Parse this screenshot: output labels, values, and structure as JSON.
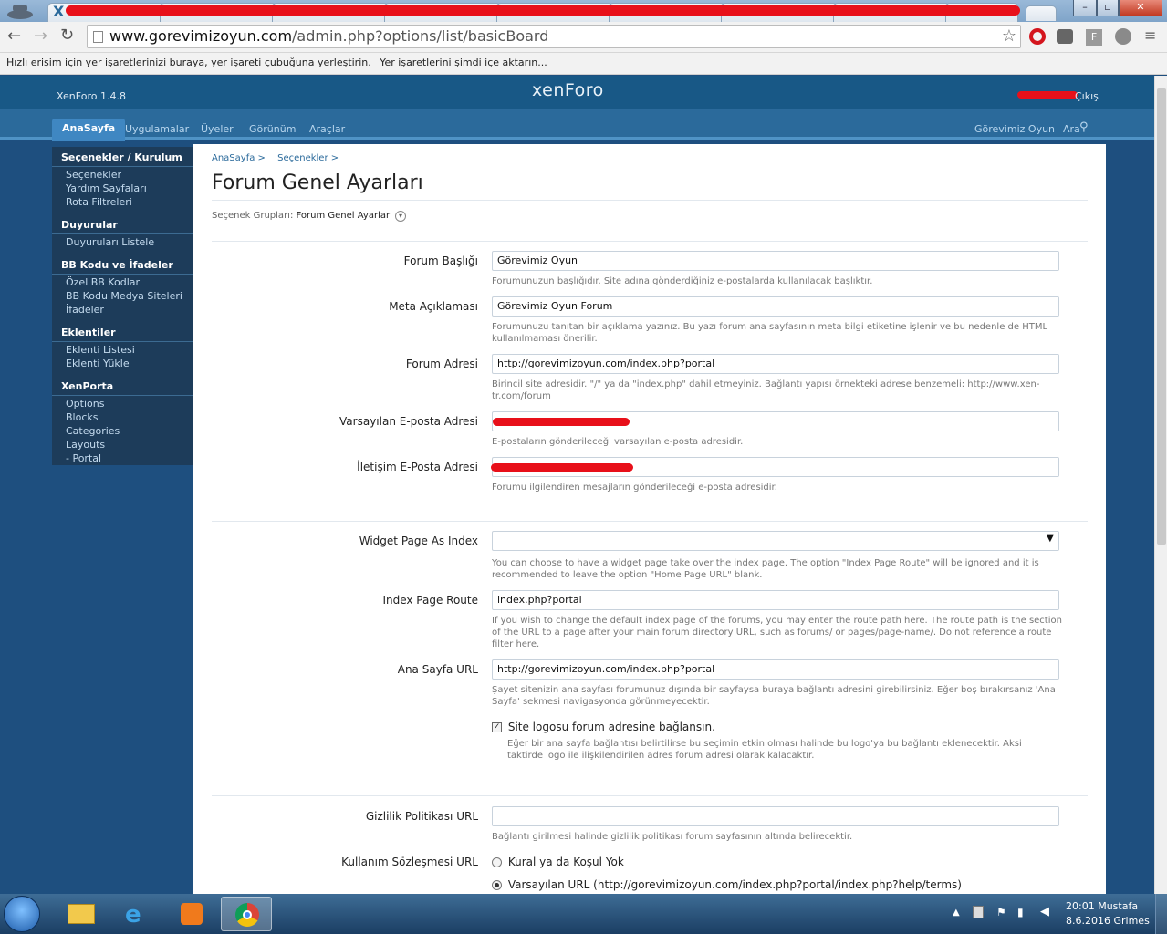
{
  "browser": {
    "url_host": "www.gorevimizoyun.com",
    "url_path": "/admin.php?options/list/basicBoard",
    "bookmarks_text": "Hızlı erişim için yer işaretlerinizi buraya, yer işareti çubuğuna yerleştirin.",
    "bookmarks_link": "Yer işaretlerini şimdi içe aktarın...",
    "tab_letter": "X"
  },
  "header": {
    "version": "XenForo 1.4.8",
    "logo": "xenForo",
    "logout": "Çıkış"
  },
  "nav": {
    "tabs": [
      "AnaSayfa",
      "Uygulamalar",
      "Üyeler",
      "Görünüm",
      "Araçlar"
    ],
    "right_site": "Görevimiz Oyun",
    "search": "Ara"
  },
  "sidebar": {
    "groups": [
      {
        "title": "Seçenekler / Kurulum",
        "items": [
          "Seçenekler",
          "Yardım Sayfaları",
          "Rota Filtreleri"
        ]
      },
      {
        "title": "Duyurular",
        "items": [
          "Duyuruları Listele"
        ]
      },
      {
        "title": "BB Kodu ve İfadeler",
        "items": [
          "Özel BB Kodlar",
          "BB Kodu Medya Siteleri",
          "İfadeler"
        ]
      },
      {
        "title": "Eklentiler",
        "items": [
          "Eklenti Listesi",
          "Eklenti Yükle"
        ]
      },
      {
        "title": "XenPorta",
        "items": [
          "Options",
          "Blocks",
          "Categories",
          "Layouts",
          "- Portal"
        ]
      }
    ]
  },
  "page": {
    "breadcrumb": [
      "AnaSayfa >",
      "Seçenekler >"
    ],
    "title": "Forum Genel Ayarları",
    "group_label": "Seçenek Grupları:",
    "group_value": "Forum Genel Ayarları"
  },
  "fields": {
    "forum_title": {
      "label": "Forum Başlığı",
      "value": "Görevimiz Oyun",
      "hint": "Forumunuzun başlığıdır. Site adına gönderdiğiniz e-postalarda kullanılacak başlıktır."
    },
    "meta": {
      "label": "Meta Açıklaması",
      "value": "Görevimiz Oyun Forum",
      "hint": "Forumunuzu tanıtan bir açıklama yazınız. Bu yazı forum ana sayfasının meta bilgi etiketine işlenir ve bu nedenle de HTML kullanılmaması önerilir."
    },
    "forum_url": {
      "label": "Forum Adresi",
      "value": "http://gorevimizoyun.com/index.php?portal",
      "hint": "Birincil site adresidir. \"/\" ya da \"index.php\" dahil etmeyiniz. Bağlantı yapısı örnekteki adrese benzemeli: http://www.xen-tr.com/forum"
    },
    "default_email": {
      "label": "Varsayılan E-posta Adresi",
      "value": "",
      "hint": "E-postaların gönderileceği varsayılan e-posta adresidir."
    },
    "contact_email": {
      "label": "İletişim E-Posta Adresi",
      "value": "",
      "hint": "Forumu ilgilendiren mesajların gönderileceği e-posta adresidir."
    },
    "widget_index": {
      "label": "Widget Page As Index",
      "value": "",
      "hint": "You can choose to have a widget page take over the index page. The option \"Index Page Route\" will be ignored and it is recommended to leave the option \"Home Page URL\" blank."
    },
    "index_route": {
      "label": "Index Page Route",
      "value": "index.php?portal",
      "hint": "If you wish to change the default index page of the forums, you may enter the route path here. The route path is the section of the URL to a page after your main forum directory URL, such as forums/ or pages/page-name/. Do not reference a route filter here."
    },
    "home_url": {
      "label": "Ana Sayfa URL",
      "value": "http://gorevimizoyun.com/index.php?portal",
      "hint": "Şayet sitenizin ana sayfası forumunuz dışında bir sayfaysa buraya bağlantı adresini girebilirsiniz. Eğer boş bırakırsanız 'Ana Sayfa' sekmesi navigasyonda görünmeyecektir."
    },
    "logo_link": {
      "label": "Site logosu forum adresine bağlansın.",
      "hint": "Eğer bir ana sayfa bağlantısı belirtilirse bu seçimin etkin olması halinde bu logo'ya bu bağlantı eklenecektir. Aksi taktirde logo ile ilişkilendirilen adres forum adresi olarak kalacaktır."
    },
    "privacy": {
      "label": "Gizlilik Politikası URL",
      "value": "",
      "hint": "Bağlantı girilmesi halinde gizlilik politikası forum sayfasının altında belirecektir."
    },
    "terms": {
      "label": "Kullanım Sözleşmesi URL",
      "opt1": "Kural ya da Koşul Yok",
      "opt2": "Varsayılan URL (http://gorevimizoyun.com/index.php?portal/index.php?help/terms)"
    }
  },
  "taskbar": {
    "time": "20:01",
    "user": "Mustafa",
    "date": "8.6.2016",
    "user2": "Grimes"
  },
  "colors": {
    "header": "#185886",
    "nav": "#2b6a9b",
    "sidebar": "#1d3c5a"
  }
}
